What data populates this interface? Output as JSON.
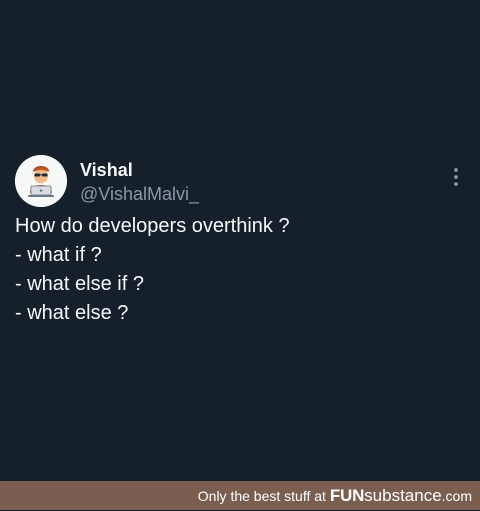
{
  "tweet": {
    "display_name": "Vishal",
    "handle": "@VishalMalvi_",
    "avatar_icon": "developer-at-laptop-avatar",
    "more_icon": "vertical-ellipsis-icon",
    "lines": [
      "How do developers overthink ?",
      "- what if ?",
      "- what else if ?",
      "- what else ?"
    ]
  },
  "footer": {
    "prefix": "Only the best stuff at ",
    "brand_bold": "FUN",
    "brand_rest": "substance",
    "tld": ".com"
  },
  "colors": {
    "background": "#15202b",
    "primary_text": "#f7f9f9",
    "secondary_text": "#8b98a5",
    "footer_background": "#7a5f50"
  }
}
